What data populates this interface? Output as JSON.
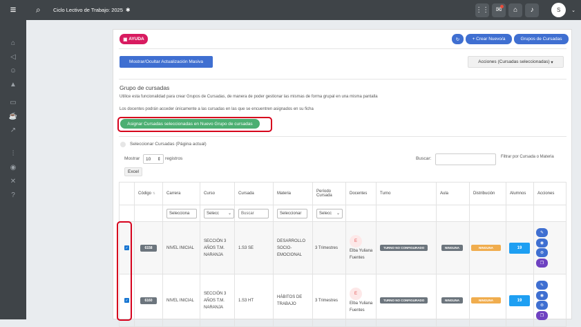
{
  "topbar": {
    "title": "Ciclo Lectivo de Trabajo: 2025",
    "avatar_letter": "S"
  },
  "buttons": {
    "ayuda": "AYUDA",
    "crear_nuevo": "+ Crear Nuevo/a",
    "grupos": "Grupos de Cursadas",
    "mostrar": "Mostrar/Ocultar Actualización Masiva",
    "acciones": "Acciones (Cursadas seleccionadas)",
    "asignar": "Asignar Cursadas seleccionadas en Nuevo Grupo de cursadas",
    "excel": "Excel"
  },
  "section": {
    "title": "Grupo de cursadas",
    "desc1": "Utilice esta funcionalidad para crear Grupos de Cursadas, de manera de poder gestionar las mismas de forma grupal en una misma pantalla",
    "desc2": "Los docentes podrán acceder únicamente a las cursadas en las que se encuentren asignados en su ficha"
  },
  "controls": {
    "select_page": "Seleccionar Cursadas (Página actual)",
    "mostrar": "Mostrar",
    "show_value": "10",
    "registros": "registros",
    "buscar": "Buscar:",
    "filtrar": "Filtrar por Cursada o Materia"
  },
  "table": {
    "headers": [
      "Código",
      "Carrera",
      "Curso",
      "Cursada",
      "Materia",
      "Período Cursada",
      "Docentes",
      "Turno",
      "Aula",
      "Distribución",
      "Alumnos",
      "Acciones"
    ],
    "filters": {
      "carrera": "Selecciona",
      "curso": "Selecc",
      "cursada": "Buscar",
      "materia": "Seleccionar",
      "periodo": "Selecc"
    },
    "rows": [
      {
        "code": "6158",
        "carrera": "NIVEL INICIAL",
        "curso": "SECCIÓN 3 AÑOS T.M. NARANJA",
        "cursada": "1.S3 SE",
        "materia": "DESARROLLO SOCIO-EMOCIONAL",
        "periodo": "3 Trimestres",
        "docente_initial": "E",
        "docente": "Elba Yuliana Fuentes",
        "turno": "TURNO NO CONFIGURADO",
        "aula": "NINGUNA",
        "distribucion": "NINGUNA",
        "alumnos": "19"
      },
      {
        "code": "6160",
        "carrera": "NIVEL INICIAL",
        "curso": "SECCIÓN 3 AÑOS T.M. NARANJA",
        "cursada": "1.S3 HT",
        "materia": "HÁBITOS DE TRABAJO",
        "periodo": "3 Trimestres",
        "docente_initial": "E",
        "docente": "Elba Yuliana Fuentes",
        "turno": "TURNO NO CONFIGURADO",
        "aula": "NINGUNA",
        "distribucion": "NINGUNA",
        "alumnos": "19"
      }
    ]
  }
}
